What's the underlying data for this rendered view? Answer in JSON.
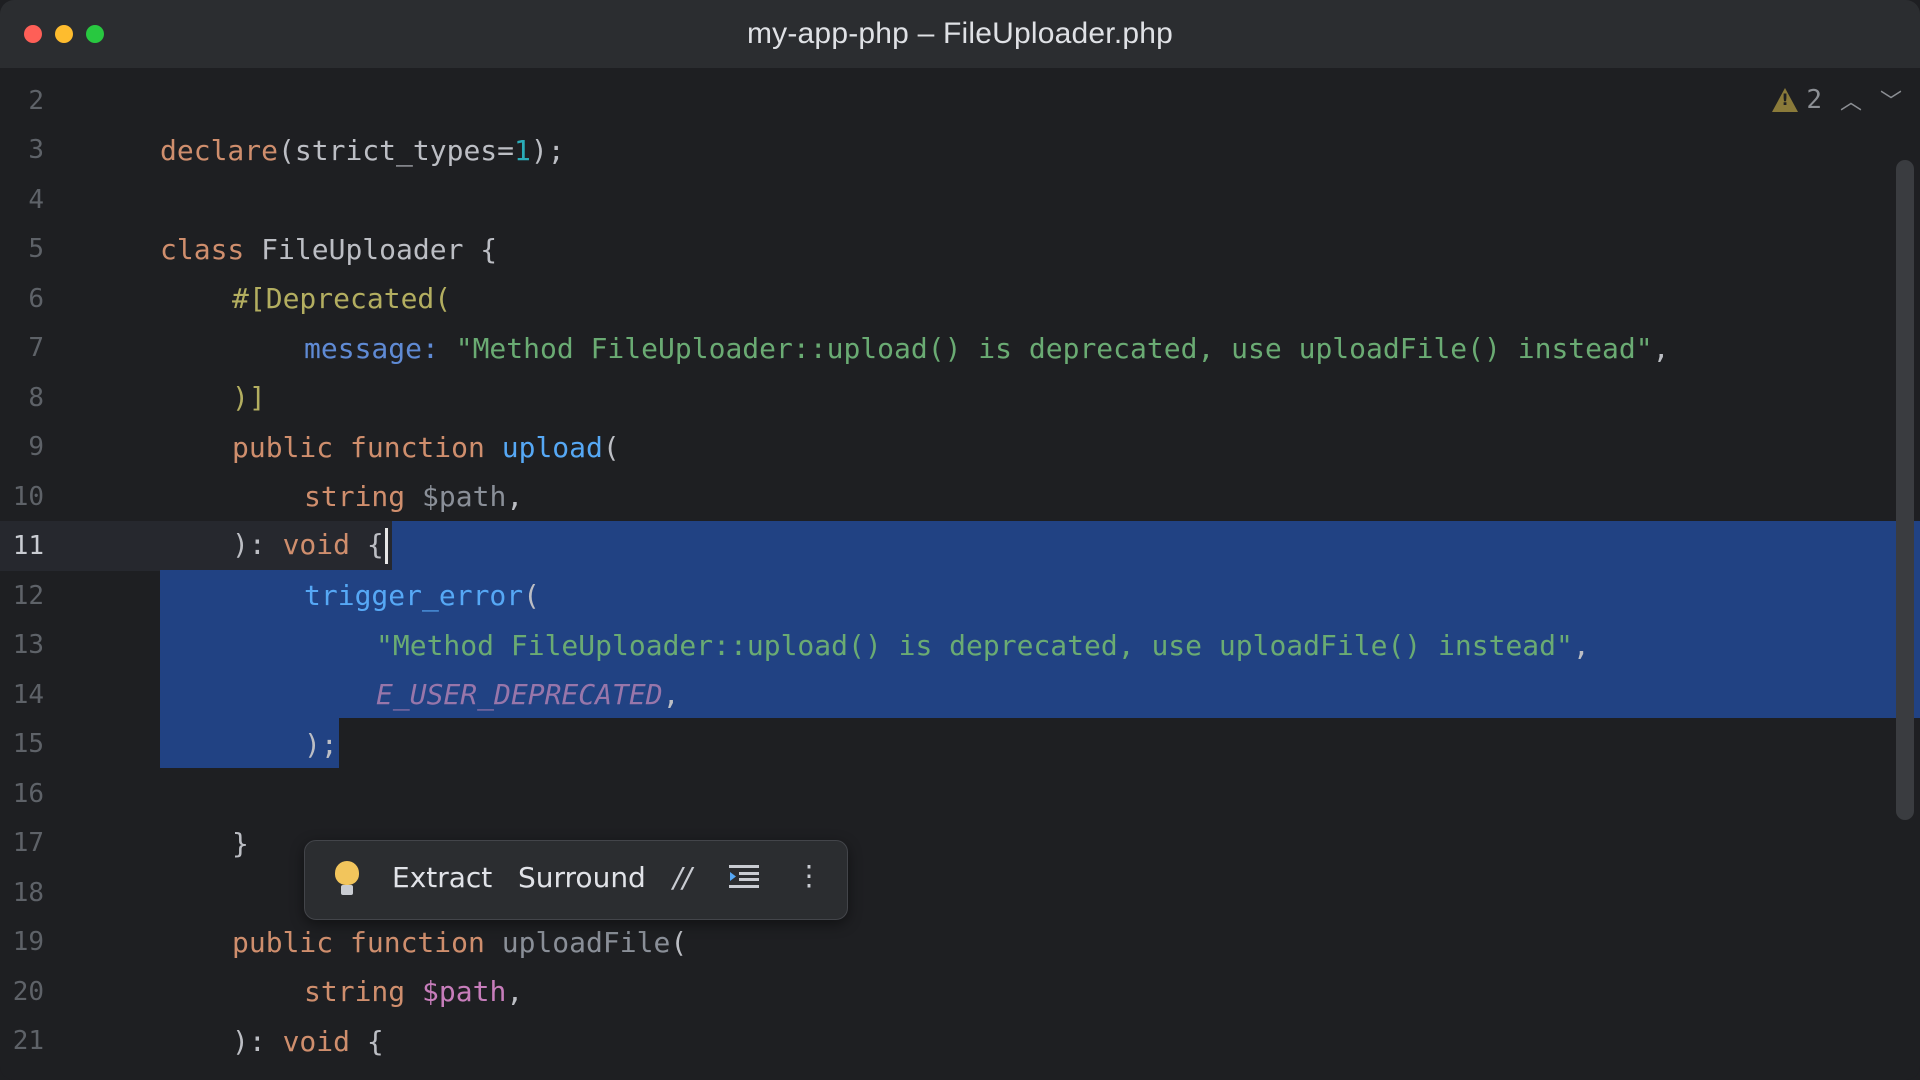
{
  "window": {
    "title": "my-app-php – FileUploader.php"
  },
  "inspection": {
    "warning_count": "2"
  },
  "icons": {
    "warning": "warning-triangle-icon",
    "prev": "chevron-up-icon",
    "next": "chevron-down-icon",
    "bulb": "lightbulb-icon",
    "comment": "comment-icon",
    "reformat": "reformat-icon",
    "more": "more-vertical-icon"
  },
  "colors": {
    "selection": "#214283",
    "keyword": "#cf8e6d",
    "function": "#56a8f5",
    "string": "#6aab73"
  },
  "editor": {
    "line_numbers": [
      "2",
      "3",
      "4",
      "5",
      "6",
      "7",
      "8",
      "9",
      "10",
      "11",
      "12",
      "13",
      "14",
      "15",
      "16",
      "17",
      "18",
      "19",
      "20",
      "21"
    ],
    "current_line": "11",
    "l3": {
      "kw": "declare",
      "a": "(strict_types=",
      "num": "1",
      "b": ");"
    },
    "l5": {
      "kw": "class",
      "name": " FileUploader {"
    },
    "l6": {
      "attr": "#[Deprecated("
    },
    "l7": {
      "param": "message:",
      "sp": " ",
      "str": "\"Method FileUploader::upload() is deprecated, use uploadFile() instead\"",
      "comma": ","
    },
    "l8": {
      "attr": ")]"
    },
    "l9": {
      "kw": "public function",
      "sp": " ",
      "fn": "upload",
      "p": "("
    },
    "l10": {
      "kw": "string",
      "sp": " ",
      "var": "$path",
      "comma": ","
    },
    "l11": {
      "a": "): ",
      "kw": "void",
      "b": " {"
    },
    "l12": {
      "fn": "trigger_error",
      "p": "("
    },
    "l13": {
      "str": "\"Method FileUploader::upload() is deprecated, use uploadFile() instead\"",
      "comma": ","
    },
    "l14": {
      "const": "E_USER_DEPRECATED",
      "comma": ","
    },
    "l15": {
      "a": ");"
    },
    "l17": {
      "a": "}"
    },
    "l19": {
      "kw": "public function",
      "sp": " ",
      "fn": "uploadFile",
      "p": "("
    },
    "l20": {
      "kw": "string",
      "sp": " ",
      "var": "$path",
      "comma": ","
    },
    "l21": {
      "a": "): ",
      "kw": "void",
      "b": " {"
    }
  },
  "popup": {
    "extract_label": "Extract",
    "surround_label": "Surround",
    "comment_glyph": "//",
    "more_glyph": "⋮"
  }
}
